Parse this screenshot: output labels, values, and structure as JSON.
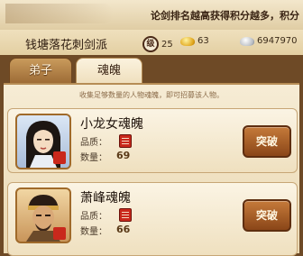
{
  "banner": {
    "text": "论剑排名越高获得积分越多，积分"
  },
  "info_bar": {
    "sect_name": "钱塘落花刺剑派",
    "rank_icon_glyph": "级",
    "rank": "25",
    "gold": "63",
    "silver": "6947970"
  },
  "tabs": [
    {
      "label": "弟子",
      "active": false
    },
    {
      "label": "魂魄",
      "active": true
    }
  ],
  "hint": "收集足够数量的人物魂魄，即可招募该人物。",
  "cards": [
    {
      "name": "小龙女魂魄",
      "quality_label": "品质：",
      "qty_label": "数量：",
      "qty": "69",
      "button": "突破"
    },
    {
      "name": "萧峰魂魄",
      "quality_label": "品质：",
      "qty_label": "数量：",
      "qty": "66",
      "button": "突破"
    }
  ],
  "colors": {
    "accent": "#c57a3a",
    "panel": "#f6ecd5",
    "quality_red": "#c9281c"
  }
}
